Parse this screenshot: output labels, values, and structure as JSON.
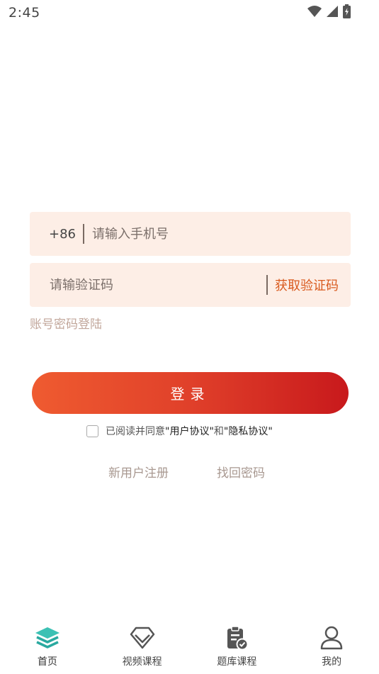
{
  "status_bar": {
    "time": "2:45"
  },
  "login_form": {
    "country_code": "+86",
    "phone_placeholder": "请输入手机号",
    "code_placeholder": "请输验证码",
    "get_code_label": "获取验证码",
    "password_login_label": "账号密码登陆",
    "login_button_label": "登录"
  },
  "agreement": {
    "prefix": "已阅读并同意",
    "user_agreement": "\"用户协议\"",
    "and": "和",
    "privacy_policy": "\"隐私协议\"",
    "checked": false
  },
  "links": {
    "register": "新用户注册",
    "forgot_password": "找回密码"
  },
  "tab_bar": {
    "items": [
      {
        "label": "首页",
        "icon": "layers-icon",
        "active": true
      },
      {
        "label": "视频课程",
        "icon": "diamond-icon",
        "active": false
      },
      {
        "label": "题库课程",
        "icon": "clipboard-check-icon",
        "active": false
      },
      {
        "label": "我的",
        "icon": "user-icon",
        "active": false
      }
    ]
  },
  "colors": {
    "accent": "#d95a1e",
    "input_bg": "#fdeee6",
    "button_start": "#ef5b30",
    "button_end": "#c8191c",
    "tab_active": "#3cc1b4"
  }
}
